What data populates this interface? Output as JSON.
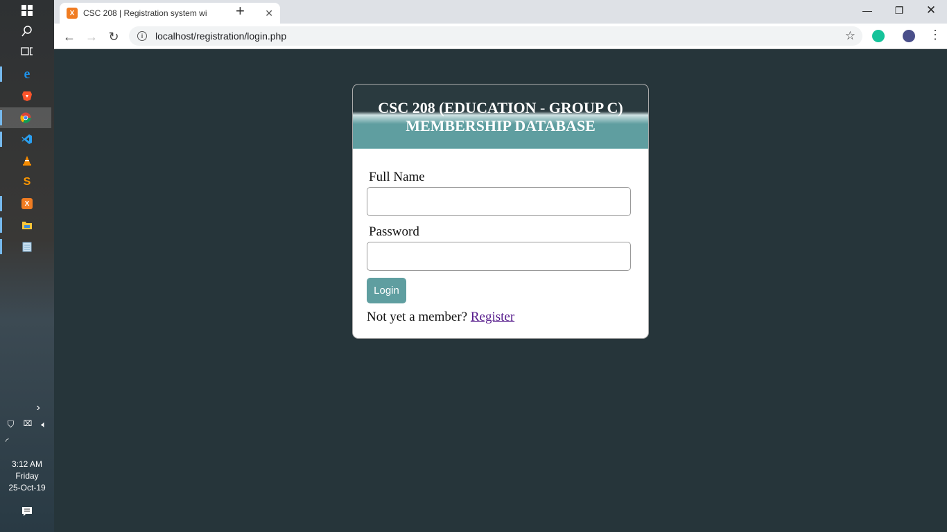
{
  "taskbar": {
    "apps": [
      {
        "name": "start-icon"
      },
      {
        "name": "search-icon"
      },
      {
        "name": "task-view-icon"
      },
      {
        "name": "edge-icon"
      },
      {
        "name": "brave-icon"
      },
      {
        "name": "chrome-icon"
      },
      {
        "name": "vscode-icon"
      },
      {
        "name": "vlc-icon"
      },
      {
        "name": "sublime-icon"
      },
      {
        "name": "xampp-icon"
      },
      {
        "name": "file-explorer-icon"
      },
      {
        "name": "notepad-icon"
      }
    ],
    "time": "3:12 AM",
    "day": "Friday",
    "date": "25-Oct-19"
  },
  "browser": {
    "tab_title": "CSC 208 | Registration system wi",
    "url": "localhost/registration/login.php"
  },
  "page": {
    "header_line1": "CSC 208 (EDUCATION - GROUP C)",
    "header_line2": "MEMBERSHIP DATABASE",
    "full_name_label": "Full Name",
    "full_name_value": "",
    "password_label": "Password",
    "password_value": "",
    "login_button": "Login",
    "member_prompt": "Not yet a member?",
    "register_link": "Register"
  },
  "colors": {
    "page_background": "#26353a",
    "accent": "#5f9ea0",
    "link": "#551a8b"
  }
}
